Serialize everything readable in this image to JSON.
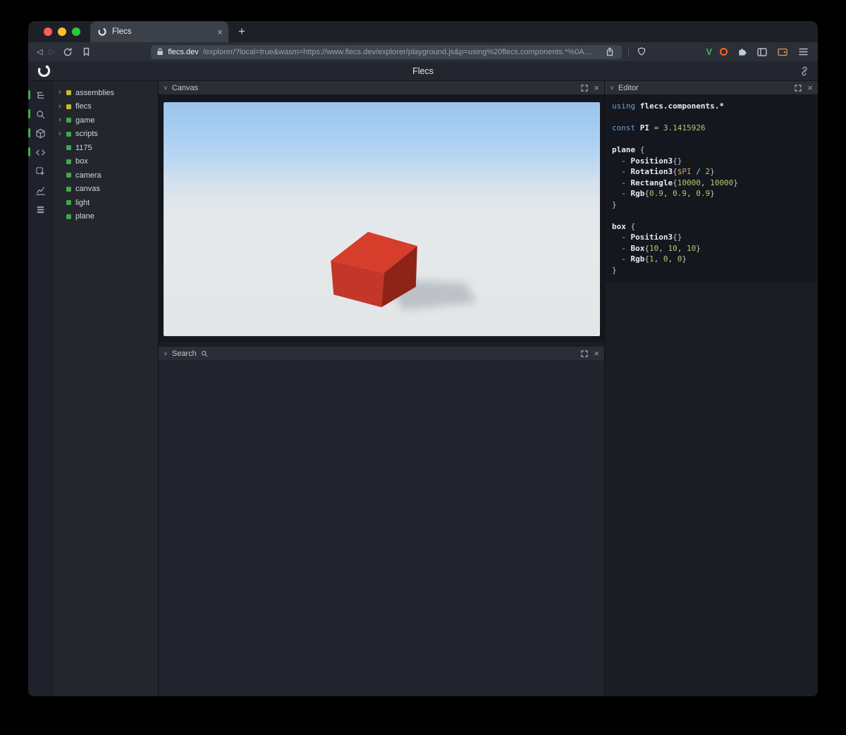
{
  "glyphs": {
    "close": "×",
    "plus": "+",
    "back": "◁",
    "forward": "▷",
    "tree_chevron": "›",
    "panel_chevron": "∨",
    "v_extension": "V"
  },
  "browser": {
    "tab": {
      "title": "Flecs"
    },
    "url": {
      "domain": "flecs.dev",
      "path": "/explorer/?local=true&wasm=https://www.flecs.dev/explorer/playground.js&p=using%20flecs.components.*%0A…"
    }
  },
  "app": {
    "title": "Flecs"
  },
  "sidebar": {
    "icons": [
      {
        "name": "hierarchy-icon",
        "icon": "hierarchy",
        "active": true
      },
      {
        "name": "search-icon",
        "icon": "search",
        "active": true
      },
      {
        "name": "cube-icon",
        "icon": "cube",
        "active": true
      },
      {
        "name": "code-icon",
        "icon": "code",
        "active": true
      },
      {
        "name": "inspect-icon",
        "icon": "inspect",
        "active": false
      },
      {
        "name": "chart-icon",
        "icon": "chart",
        "active": false
      },
      {
        "name": "stack-icon",
        "icon": "stack",
        "active": false
      }
    ]
  },
  "tree": {
    "items": [
      {
        "label": "assemblies",
        "dot": "yellow",
        "chevron": true
      },
      {
        "label": "flecs",
        "dot": "yellow",
        "chevron": true
      },
      {
        "label": "game",
        "dot": "green",
        "chevron": true
      },
      {
        "label": "scripts",
        "dot": "green",
        "chevron": true
      },
      {
        "label": "1175",
        "dot": "green",
        "chevron": false
      },
      {
        "label": "box",
        "dot": "green",
        "chevron": false
      },
      {
        "label": "camera",
        "dot": "green",
        "chevron": false
      },
      {
        "label": "canvas",
        "dot": "green",
        "chevron": false
      },
      {
        "label": "light",
        "dot": "green",
        "chevron": false
      },
      {
        "label": "plane",
        "dot": "green",
        "chevron": false
      }
    ]
  },
  "panels": {
    "canvas": {
      "title": "Canvas"
    },
    "search": {
      "title": "Search"
    },
    "editor": {
      "title": "Editor"
    }
  },
  "code": {
    "lines": [
      [
        {
          "t": "using",
          "c": "kw"
        },
        {
          "t": " ",
          "c": "pl"
        },
        {
          "t": "flecs.components.*",
          "c": "id"
        }
      ],
      [],
      [
        {
          "t": "const",
          "c": "kw"
        },
        {
          "t": " ",
          "c": "pl"
        },
        {
          "t": "PI",
          "c": "id"
        },
        {
          "t": " = ",
          "c": "pl"
        },
        {
          "t": "3.1415926",
          "c": "num"
        }
      ],
      [],
      [
        {
          "t": "plane",
          "c": "id"
        },
        {
          "t": " {",
          "c": "pl"
        }
      ],
      [
        {
          "t": "  - ",
          "c": "pl"
        },
        {
          "t": "Position3",
          "c": "id"
        },
        {
          "t": "{}",
          "c": "pl"
        }
      ],
      [
        {
          "t": "  - ",
          "c": "pl"
        },
        {
          "t": "Rotation3",
          "c": "id"
        },
        {
          "t": "{",
          "c": "pl"
        },
        {
          "t": "$PI",
          "c": "var"
        },
        {
          "t": " / ",
          "c": "pl"
        },
        {
          "t": "2",
          "c": "num"
        },
        {
          "t": "}",
          "c": "pl"
        }
      ],
      [
        {
          "t": "  - ",
          "c": "pl"
        },
        {
          "t": "Rectangle",
          "c": "id"
        },
        {
          "t": "{",
          "c": "pl"
        },
        {
          "t": "10000",
          "c": "num"
        },
        {
          "t": ", ",
          "c": "pl"
        },
        {
          "t": "10000",
          "c": "num"
        },
        {
          "t": "}",
          "c": "pl"
        }
      ],
      [
        {
          "t": "  - ",
          "c": "pl"
        },
        {
          "t": "Rgb",
          "c": "id"
        },
        {
          "t": "{",
          "c": "pl"
        },
        {
          "t": "0.9",
          "c": "num"
        },
        {
          "t": ", ",
          "c": "pl"
        },
        {
          "t": "0.9",
          "c": "num"
        },
        {
          "t": ", ",
          "c": "pl"
        },
        {
          "t": "0.9",
          "c": "num"
        },
        {
          "t": "}",
          "c": "pl"
        }
      ],
      [
        {
          "t": "}",
          "c": "pl"
        }
      ],
      [],
      [
        {
          "t": "box",
          "c": "id"
        },
        {
          "t": " {",
          "c": "pl"
        }
      ],
      [
        {
          "t": "  - ",
          "c": "pl"
        },
        {
          "t": "Position3",
          "c": "id"
        },
        {
          "t": "{}",
          "c": "pl"
        }
      ],
      [
        {
          "t": "  - ",
          "c": "pl"
        },
        {
          "t": "Box",
          "c": "id"
        },
        {
          "t": "{",
          "c": "pl"
        },
        {
          "t": "10",
          "c": "num"
        },
        {
          "t": ", ",
          "c": "pl"
        },
        {
          "t": "10",
          "c": "num"
        },
        {
          "t": ", ",
          "c": "pl"
        },
        {
          "t": "10",
          "c": "num"
        },
        {
          "t": "}",
          "c": "pl"
        }
      ],
      [
        {
          "t": "  - ",
          "c": "pl"
        },
        {
          "t": "Rgb",
          "c": "id"
        },
        {
          "t": "{",
          "c": "pl"
        },
        {
          "t": "1",
          "c": "num"
        },
        {
          "t": ", ",
          "c": "pl"
        },
        {
          "t": "0",
          "c": "num"
        },
        {
          "t": ", ",
          "c": "pl"
        },
        {
          "t": "0",
          "c": "num"
        },
        {
          "t": "}",
          "c": "pl"
        }
      ],
      [
        {
          "t": "}",
          "c": "pl"
        }
      ]
    ]
  },
  "colors": {
    "accent_green": "#43b04a",
    "dot_green": "#3fa94b",
    "dot_yellow": "#c9b834",
    "box_top": "#d63d2b",
    "box_front": "#c4362a",
    "box_right": "#8e2319",
    "shadow": "#858d97",
    "traffic_red": "#ff5f57",
    "traffic_yellow": "#febc2e",
    "traffic_green": "#28c840"
  }
}
